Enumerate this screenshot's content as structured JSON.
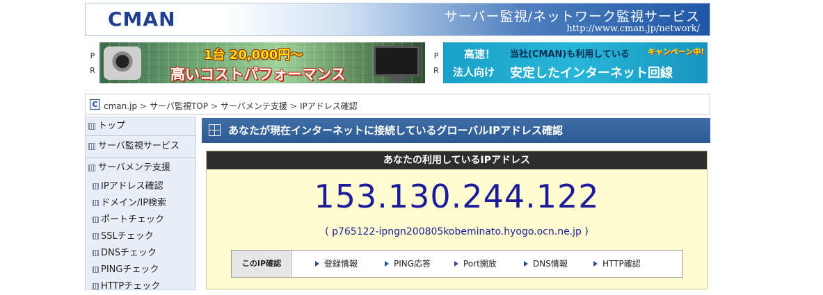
{
  "header": {
    "logo": "CMAN",
    "title": "サーバー監視/ネットワーク監視サービス",
    "url": "http://www.cman.jp/network/"
  },
  "ads": {
    "pr_label": [
      "P",
      "R"
    ],
    "banner1": {
      "line1": "1台 20,000円〜",
      "line2": "高いコストパフォーマンス"
    },
    "banner2": {
      "tag1": "高速！",
      "tag2": "法人向け",
      "line1": "当社(CMAN)も利用している",
      "badge": "キャンペーン中!",
      "line2": "安定したインターネット回線"
    }
  },
  "breadcrumb": {
    "icon": "C",
    "items": [
      "cman.jp",
      "サーバ監視TOP",
      "サーバメンテ支援",
      "IPアドレス確認"
    ],
    "separator": ">"
  },
  "sidebar": {
    "top_items": [
      {
        "label": "トップ"
      },
      {
        "label": "サーバ監視サービス"
      },
      {
        "label": "サーバメンテ支援"
      }
    ],
    "sub_items": [
      {
        "label": "IPアドレス確認"
      },
      {
        "label": "ドメイン/IP検索"
      },
      {
        "label": "ポートチェック"
      },
      {
        "label": "SSLチェック"
      },
      {
        "label": "DNSチェック"
      },
      {
        "label": "PINGチェック"
      },
      {
        "label": "HTTPチェック"
      }
    ]
  },
  "main": {
    "title": "あなたが現在インターネットに接続しているグローバルIPアドレス確認",
    "box_header": "あなたの利用しているIPアドレス",
    "ip_address": "153.130.244.122",
    "hostname": "( p765122-ipngn200805kobeminato.hyogo.ocn.ne.jp )",
    "actions_label": "このIP確認",
    "actions": [
      "登録情報",
      "PING応答",
      "Port開放",
      "DNS情報",
      "HTTP確認"
    ]
  },
  "colors": {
    "accent": "#2c5a92",
    "ip_text": "#1b1b9c",
    "box_bg": "#fffcd0",
    "box_header": "#2e2e2e"
  }
}
